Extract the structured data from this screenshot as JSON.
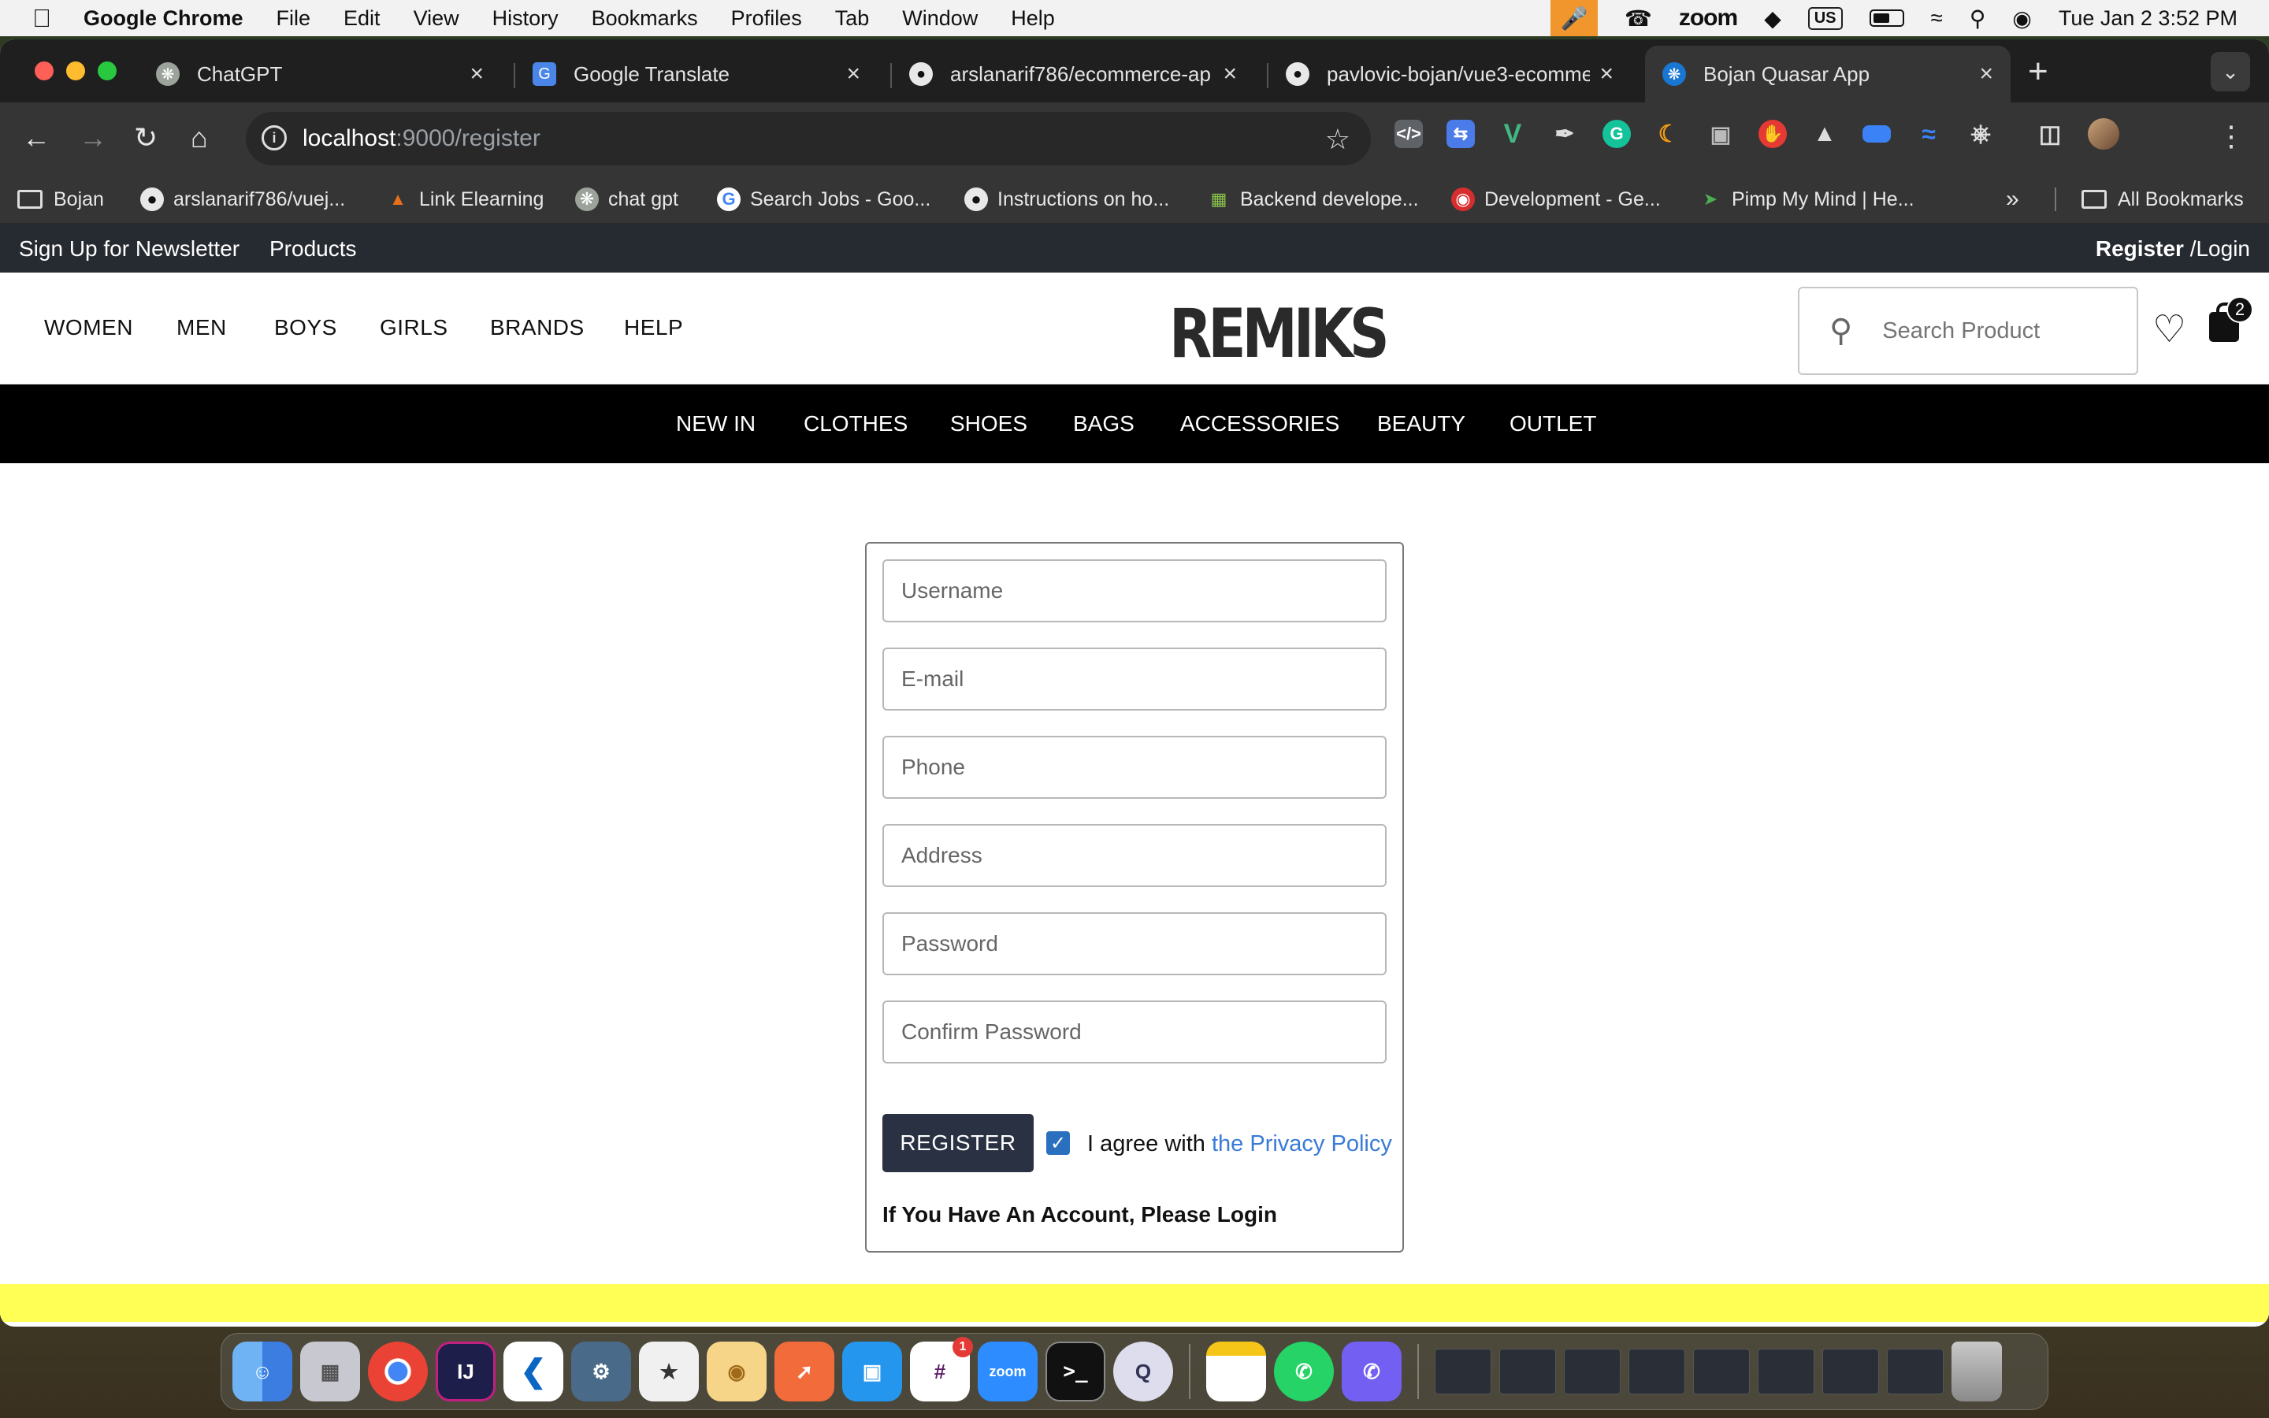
{
  "menubar": {
    "app_name": "Google Chrome",
    "items": [
      "File",
      "Edit",
      "View",
      "History",
      "Bookmarks",
      "Profiles",
      "Tab",
      "Window",
      "Help"
    ],
    "zoom_label": "zoom",
    "input_source": "US",
    "datetime": "Tue Jan 2  3:52 PM"
  },
  "tabs": [
    {
      "title": "ChatGPT"
    },
    {
      "title": "Google Translate"
    },
    {
      "title": "arslanarif786/ecommerce-ap"
    },
    {
      "title": "pavlovic-bojan/vue3-ecomme"
    },
    {
      "title": "Bojan Quasar App"
    }
  ],
  "omnibox": {
    "host": "localhost",
    "path": ":9000/register"
  },
  "bookmarks": [
    {
      "label": "Bojan"
    },
    {
      "label": "arslanarif786/vuej..."
    },
    {
      "label": "Link Elearning"
    },
    {
      "label": "chat gpt"
    },
    {
      "label": "Search Jobs - Goo..."
    },
    {
      "label": "Instructions on ho..."
    },
    {
      "label": "Backend develope..."
    },
    {
      "label": "Development - Ge..."
    },
    {
      "label": "Pimp My Mind | He..."
    }
  ],
  "all_bookmarks": "All Bookmarks",
  "site": {
    "topbar": {
      "newsletter": "Sign Up for Newsletter",
      "products": "Products",
      "register": "Register",
      "login": " /Login"
    },
    "main_nav": [
      "WOMEN",
      "MEN",
      "BOYS",
      "GIRLS",
      "BRANDS",
      "HELP"
    ],
    "logo": "REMIKS",
    "search_placeholder": "Search Product",
    "cart_count": "2",
    "categories": [
      "NEW IN",
      "CLOTHES",
      "SHOES",
      "BAGS",
      "ACCESSORIES",
      "BEAUTY",
      "OUTLET"
    ]
  },
  "form": {
    "fields": [
      {
        "placeholder": "Username"
      },
      {
        "placeholder": "E-mail"
      },
      {
        "placeholder": "Phone"
      },
      {
        "placeholder": "Address"
      },
      {
        "placeholder": "Password"
      },
      {
        "placeholder": "Confirm Password"
      }
    ],
    "register_button": "REGISTER",
    "agree_text": "I agree with ",
    "privacy_link": "the Privacy Policy",
    "agree_checked": true,
    "login_prompt": "If You Have An Account, Please Login"
  },
  "colors": {
    "topbar_bg": "#262a31",
    "category_bar_bg": "#000000",
    "register_button_bg": "#2a3142",
    "link": "#3a7bd5",
    "footer_band": "#ffff55"
  },
  "dock": {
    "slack_badge": "1",
    "zoom_label": "zoom"
  }
}
